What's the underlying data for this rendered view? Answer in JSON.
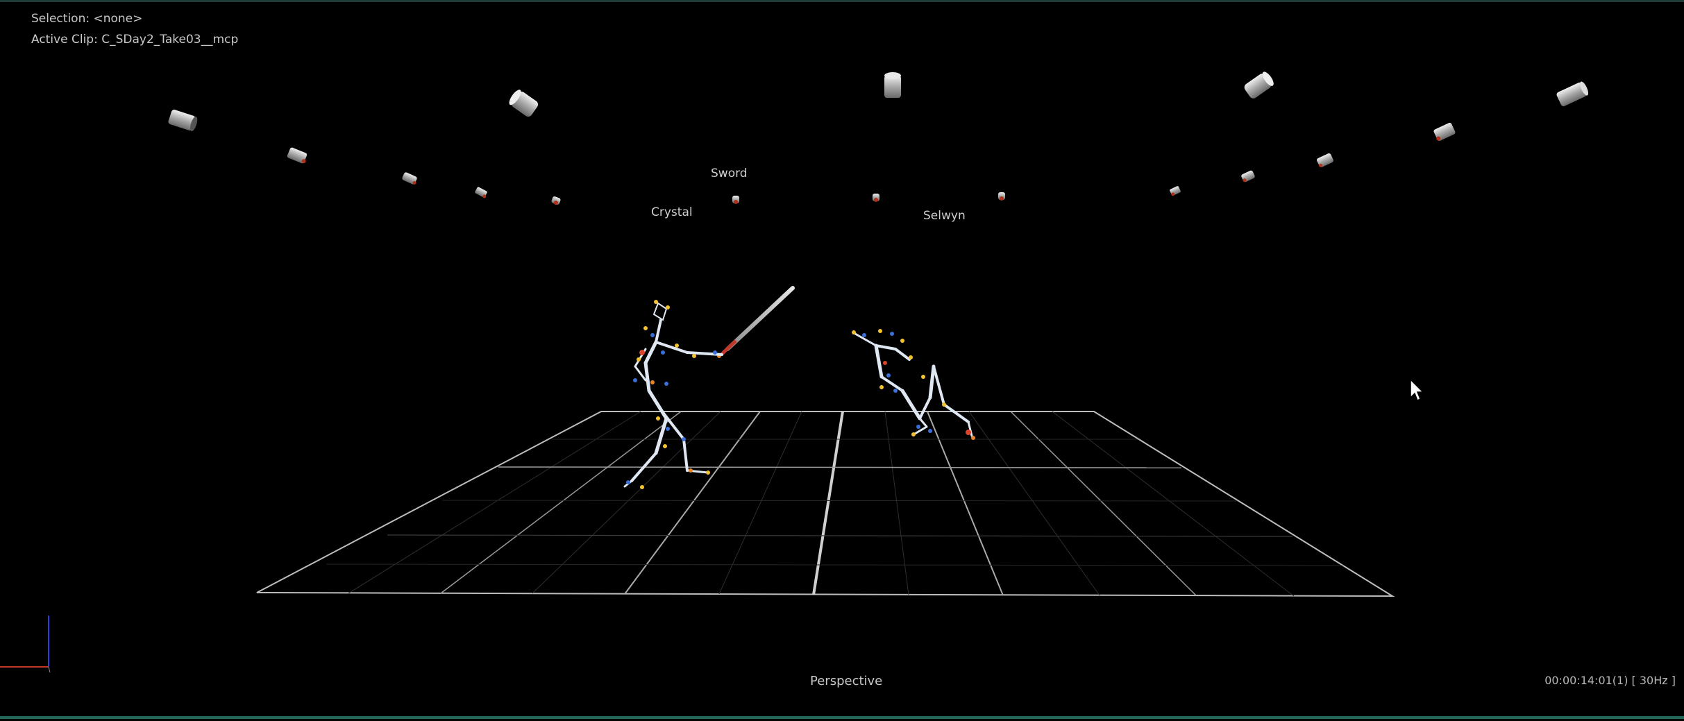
{
  "hud": {
    "selection": "Selection: <none>",
    "active_clip": "Active Clip: C_SDay2_Take03__mcp",
    "view_name": "Perspective",
    "timecode": "00:00:14:01(1) [ 30Hz ]"
  },
  "subjects": [
    {
      "label": "Sword"
    },
    {
      "label": "Crystal"
    },
    {
      "label": "Selwyn"
    }
  ],
  "colors": {
    "background": "#000000",
    "grid": "#c8c8c8",
    "bone": "#dfe8f2",
    "marker_yellow": "#f2c230",
    "marker_red": "#d9442b",
    "marker_blue": "#3a6fd8",
    "marker_orange": "#e8862a",
    "camera_body": "#bdbdbd",
    "axis_x": "#c0392b",
    "axis_y": "#2f3fd6"
  },
  "icons": {
    "cursor": "mouse-pointer-icon",
    "axis": "axis-gizmo-icon",
    "camera": "mocap-camera-icon"
  }
}
